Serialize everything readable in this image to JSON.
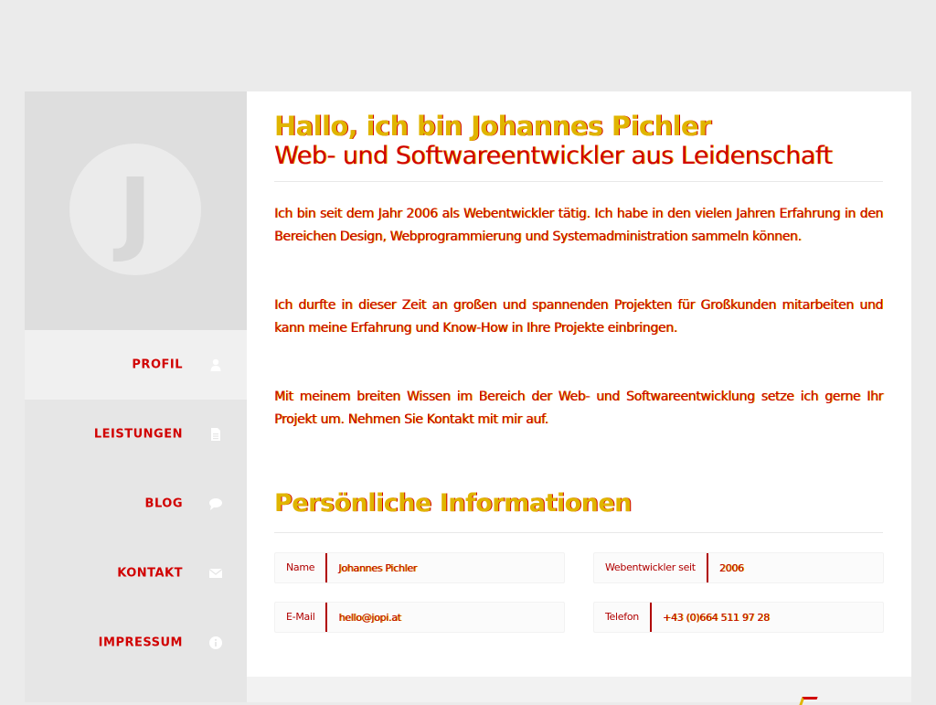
{
  "sidebar": {
    "avatar_letter": "J",
    "nav": [
      {
        "label": "PROFIL",
        "icon": "user-icon"
      },
      {
        "label": "LEISTUNGEN",
        "icon": "document-icon"
      },
      {
        "label": "BLOG",
        "icon": "comment-icon"
      },
      {
        "label": "KONTAKT",
        "icon": "envelope-icon"
      },
      {
        "label": "IMPRESSUM",
        "icon": "info-icon"
      }
    ]
  },
  "main": {
    "title": "Hallo, ich bin Johannes Pichler",
    "subtitle": "Web- und Softwareentwickler aus Leidenschaft",
    "paragraphs": [
      "Ich bin seit dem Jahr 2006 als Webentwickler tätig. Ich habe in den vielen Jahren Erfahrung in den Bereichen Design, Webprogrammierung und Systemadministration sammeln können.",
      "Ich durfte in dieser Zeit an großen und spannenden Projekten für Großkunden mitarbeiten und kann meine Erfahrung und Know-How in Ihre Projekte einbringen.",
      "Mit meinem breiten Wissen im Bereich der Web- und Softwareentwicklung setze ich gerne Ihr Projekt um. Nehmen Sie Kontakt mit mir auf."
    ],
    "section_title": "Persönliche Informationen",
    "info": [
      {
        "label": "Name",
        "value": "Johannes Pichler"
      },
      {
        "label": "Webentwickler seit",
        "value": "2006"
      },
      {
        "label": "E-Mail",
        "value": "hello@jopi.at"
      },
      {
        "label": "Telefon",
        "value": "+43 (0)664 511 97 28"
      }
    ]
  },
  "colors": {
    "accent_red": "#d10000",
    "accent_yellow": "#e0b500",
    "background": "#ebebeb"
  }
}
